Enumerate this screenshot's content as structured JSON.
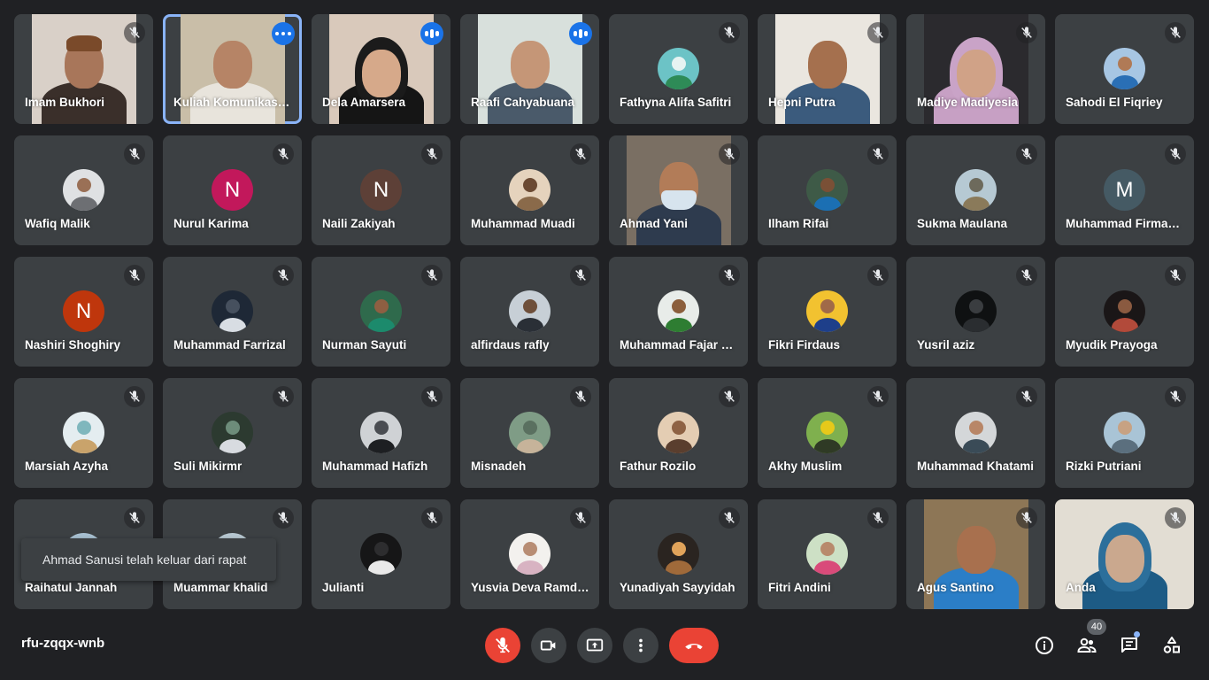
{
  "meeting": {
    "code": "rfu-zqqx-wnb"
  },
  "notification": "Ahmad Sanusi telah keluar dari rapat",
  "participants_badge": "40",
  "colors": {
    "background": "#202124",
    "tile": "#3c4043",
    "active_border": "#8ab4f8",
    "speaking": "#1a73e8",
    "end_call": "#ea4335"
  },
  "participants": [
    {
      "name": "Imam Bukhori",
      "kind": "video",
      "muted": true,
      "bg": "#d9d0c8",
      "skin": "#a8765a",
      "shirt": "#3a2f2a",
      "cap": "#7a4a2a"
    },
    {
      "name": "Kuliah Komunikasi Islam",
      "kind": "video",
      "muted": false,
      "active": true,
      "indicator": "dots",
      "bg": "#c9bea8",
      "skin": "#b68466",
      "shirt": "#e8e4dc"
    },
    {
      "name": "Dela Amarsera",
      "kind": "video",
      "muted": false,
      "indicator": "bars",
      "bg": "#d9c9bb",
      "skin": "#d6a98a",
      "shirt": "#151515",
      "hijab": "#1b1b1b"
    },
    {
      "name": "Raafi Cahyabuana",
      "kind": "video",
      "muted": false,
      "indicator": "bars",
      "bg": "#d8e0dc",
      "skin": "#c59677",
      "shirt": "#4a5a6a"
    },
    {
      "name": "Fathyna Alifa Safitri",
      "kind": "avatar",
      "muted": true,
      "avatar": {
        "type": "photo",
        "bg": "#6cc3c6",
        "body": "#2e8b57",
        "head": "#e6f3f2"
      }
    },
    {
      "name": "Hepni Putra",
      "kind": "video",
      "muted": true,
      "bg": "#eae6df",
      "skin": "#a5704e",
      "shirt": "#3b5b7d"
    },
    {
      "name": "Madiye Madiyesia",
      "kind": "video",
      "muted": true,
      "bg": "#2b2a2e",
      "skin": "#d0a287",
      "shirt": "#c7a0c4",
      "hijab": "#c9a3c7"
    },
    {
      "name": "Sahodi El Fiqriey",
      "kind": "avatar",
      "muted": true,
      "avatar": {
        "type": "photo",
        "bg": "#a7c6e3",
        "body": "#2a6fb5",
        "head": "#b07a56"
      }
    },
    {
      "name": "Wafiq Malik",
      "kind": "avatar",
      "muted": true,
      "avatar": {
        "type": "photo",
        "bg": "#dfe1e3",
        "body": "#6d6f73",
        "head": "#9a7056"
      }
    },
    {
      "name": "Nurul Karima",
      "kind": "avatar",
      "muted": true,
      "avatar": {
        "type": "letter",
        "letter": "N",
        "bg": "#c2185b"
      }
    },
    {
      "name": "Naili Zakiyah",
      "kind": "avatar",
      "muted": true,
      "avatar": {
        "type": "letter",
        "letter": "N",
        "bg": "#5d4037"
      }
    },
    {
      "name": "Muhammad Muadi",
      "kind": "avatar",
      "muted": true,
      "avatar": {
        "type": "photo",
        "bg": "#e5d3bd",
        "body": "#8a6a4a",
        "head": "#6b4a33"
      }
    },
    {
      "name": "Ahmad Yani",
      "kind": "video",
      "muted": true,
      "bg": "#7a6f63",
      "skin": "#b27c58",
      "shirt": "#2e3b4e",
      "mask": "#d7e4ee"
    },
    {
      "name": "Ilham Rifai",
      "kind": "avatar",
      "muted": true,
      "avatar": {
        "type": "photo",
        "bg": "#3e5a47",
        "body": "#1b6fb3",
        "head": "#7a5036"
      }
    },
    {
      "name": "Sukma Maulana",
      "kind": "avatar",
      "muted": true,
      "avatar": {
        "type": "photo",
        "bg": "#b6c9d3",
        "body": "#8a7a5a",
        "head": "#6d6a5c"
      }
    },
    {
      "name": "Muhammad Firmansyah",
      "kind": "avatar",
      "muted": true,
      "avatar": {
        "type": "letter",
        "letter": "M",
        "bg": "#455a64"
      }
    },
    {
      "name": "Nashiri Shoghiry",
      "kind": "avatar",
      "muted": true,
      "avatar": {
        "type": "letter",
        "letter": "N",
        "bg": "#bf360c"
      }
    },
    {
      "name": "Muhammad Farrizal",
      "kind": "avatar",
      "muted": true,
      "avatar": {
        "type": "photo",
        "bg": "#1e2836",
        "body": "#d8dde3",
        "head": "#46505e"
      }
    },
    {
      "name": "Nurman Sayuti",
      "kind": "avatar",
      "muted": true,
      "avatar": {
        "type": "photo",
        "bg": "#2f6a4c",
        "body": "#1c8a6c",
        "head": "#8e5f42"
      }
    },
    {
      "name": "alfirdaus rafly",
      "kind": "avatar",
      "muted": true,
      "avatar": {
        "type": "photo",
        "bg": "#c7cfd6",
        "body": "#2a2f36",
        "head": "#6e4f3a"
      }
    },
    {
      "name": "Muhammad Fajar Sidik",
      "kind": "avatar",
      "muted": true,
      "avatar": {
        "type": "photo",
        "bg": "#e8ece9",
        "body": "#2e7d32",
        "head": "#8b5e3c"
      }
    },
    {
      "name": "Fikri Firdaus",
      "kind": "avatar",
      "muted": true,
      "avatar": {
        "type": "photo",
        "bg": "#f2c230",
        "body": "#1e3f8a",
        "head": "#a06a48"
      }
    },
    {
      "name": "Yusril aziz",
      "kind": "avatar",
      "muted": true,
      "avatar": {
        "type": "photo",
        "bg": "#0f1112",
        "body": "#2a2d30",
        "head": "#3a3d40"
      }
    },
    {
      "name": "Myudik Prayoga",
      "kind": "avatar",
      "muted": true,
      "avatar": {
        "type": "photo",
        "bg": "#1a1617",
        "body": "#b24a3a",
        "head": "#8a5a40"
      }
    },
    {
      "name": "Marsiah Azyha",
      "kind": "avatar",
      "muted": true,
      "avatar": {
        "type": "photo",
        "bg": "#e4edf0",
        "body": "#c9a36b",
        "head": "#7fb7bd"
      }
    },
    {
      "name": "Suli Mikirmr",
      "kind": "avatar",
      "muted": true,
      "avatar": {
        "type": "photo",
        "bg": "#2c3a30",
        "body": "#d8dbe0",
        "head": "#6d8c7a"
      }
    },
    {
      "name": "Muhammad Hafizh",
      "kind": "avatar",
      "muted": true,
      "avatar": {
        "type": "photo",
        "bg": "#cfd2d5",
        "body": "#1d1f22",
        "head": "#4a4d52"
      }
    },
    {
      "name": "Misnadeh",
      "kind": "avatar",
      "muted": true,
      "avatar": {
        "type": "photo",
        "bg": "#7f9c86",
        "body": "#c6b39a",
        "head": "#5a7060"
      }
    },
    {
      "name": "Fathur Rozilo",
      "kind": "avatar",
      "muted": true,
      "avatar": {
        "type": "photo",
        "bg": "#e4cdb3",
        "body": "#5a3e2e",
        "head": "#8e6244"
      }
    },
    {
      "name": "Akhy Muslim",
      "kind": "avatar",
      "muted": true,
      "avatar": {
        "type": "photo",
        "bg": "#7fb04e",
        "body": "#2f3a25",
        "head": "#e6c91a"
      }
    },
    {
      "name": "Muhammad Khatami",
      "kind": "avatar",
      "muted": true,
      "avatar": {
        "type": "photo",
        "bg": "#d4d7d9",
        "body": "#3a4b57",
        "head": "#b88667"
      }
    },
    {
      "name": "Rizki Putriani",
      "kind": "avatar",
      "muted": true,
      "avatar": {
        "type": "photo",
        "bg": "#a9c4d6",
        "body": "#5b6f7e",
        "head": "#c7a283"
      }
    },
    {
      "name": "Raihatul Jannah",
      "kind": "avatar",
      "muted": true,
      "avatar": {
        "type": "photo",
        "bg": "#a8c1d2",
        "body": "#6b7a86",
        "head": "#c8a88c"
      }
    },
    {
      "name": "Muammar khalid",
      "kind": "avatar",
      "muted": true,
      "avatar": {
        "type": "photo",
        "bg": "#b9c9d3",
        "body": "#7d8892",
        "head": "#b89074"
      }
    },
    {
      "name": "Julianti",
      "kind": "avatar",
      "muted": true,
      "avatar": {
        "type": "photo",
        "bg": "#161617",
        "body": "#e9e9e9",
        "head": "#2d2d2f"
      }
    },
    {
      "name": "Yusvia Deva Ramdani",
      "kind": "avatar",
      "muted": true,
      "avatar": {
        "type": "photo",
        "bg": "#f3f1ee",
        "body": "#d8b3c2",
        "head": "#b88d74"
      }
    },
    {
      "name": "Yunadiyah Sayyidah",
      "kind": "avatar",
      "muted": true,
      "avatar": {
        "type": "photo",
        "bg": "#2a2420",
        "body": "#a06a3a",
        "head": "#e0a35a"
      }
    },
    {
      "name": "Fitri Andini",
      "kind": "avatar",
      "muted": true,
      "avatar": {
        "type": "photo",
        "bg": "#cde0c5",
        "body": "#d94b7a",
        "head": "#b88a6c"
      }
    },
    {
      "name": "Agus Santino",
      "kind": "video",
      "muted": true,
      "bg": "#8d7656",
      "skin": "#a8704e",
      "shirt": "#2b7ec7"
    },
    {
      "name": "Anda",
      "kind": "video",
      "muted": true,
      "full": true,
      "bg": "#e2ddd3",
      "skin": "#caa88e",
      "shirt": "#1d5b85",
      "hijab": "#2c6f9b"
    }
  ],
  "controls": [
    {
      "id": "mic",
      "icon": "mic-off-icon",
      "style": "red"
    },
    {
      "id": "camera",
      "icon": "videocam-icon",
      "style": "dark"
    },
    {
      "id": "present",
      "icon": "present-screen-icon",
      "style": "dark"
    },
    {
      "id": "more",
      "icon": "more-vert-icon",
      "style": "dark"
    },
    {
      "id": "end",
      "icon": "call-end-icon",
      "style": "pill"
    }
  ]
}
